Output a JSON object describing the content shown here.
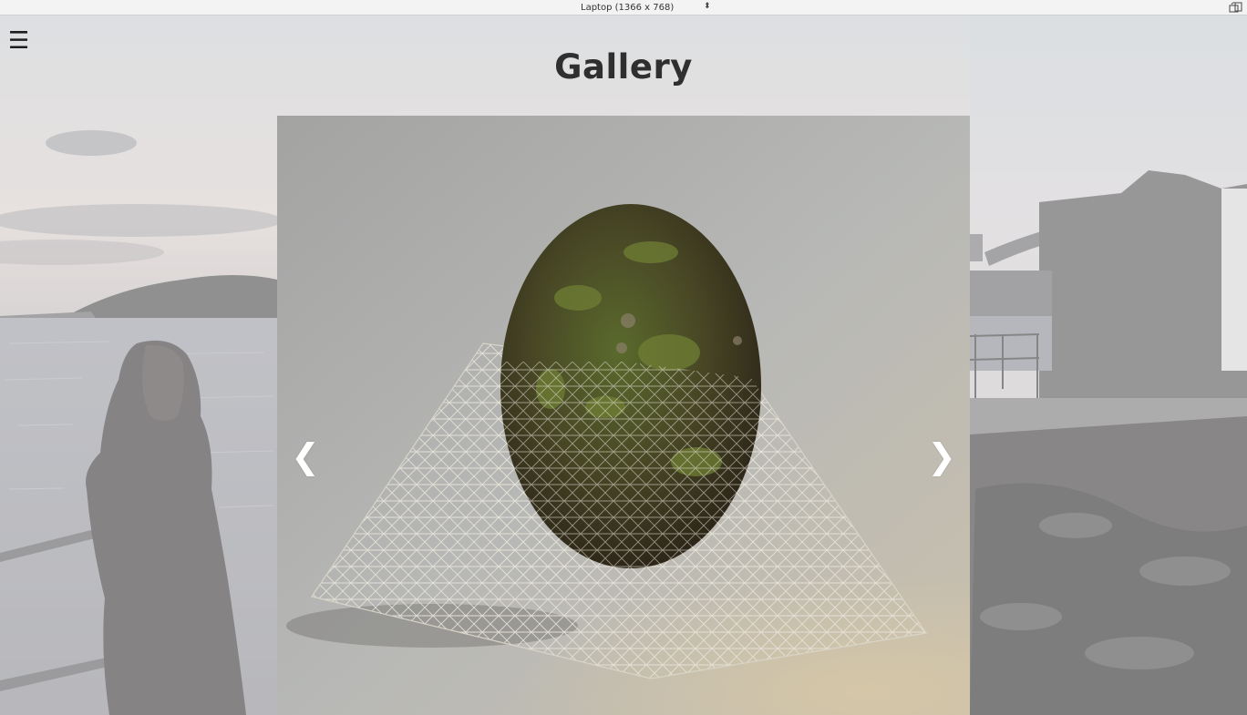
{
  "devtools": {
    "device_label": "Laptop (1366 x 768)",
    "device_arrow": "⬍",
    "rotate_icon": "rotate-device-icon"
  },
  "page": {
    "menu_icon": "☰",
    "title": "Gallery"
  },
  "slider": {
    "prev_label": "❮",
    "next_label": "❯"
  },
  "colors": {
    "title": "#2f2f2f",
    "nav_arrows": "#ffffff",
    "toolbar_bg": "#f3f3f3"
  }
}
